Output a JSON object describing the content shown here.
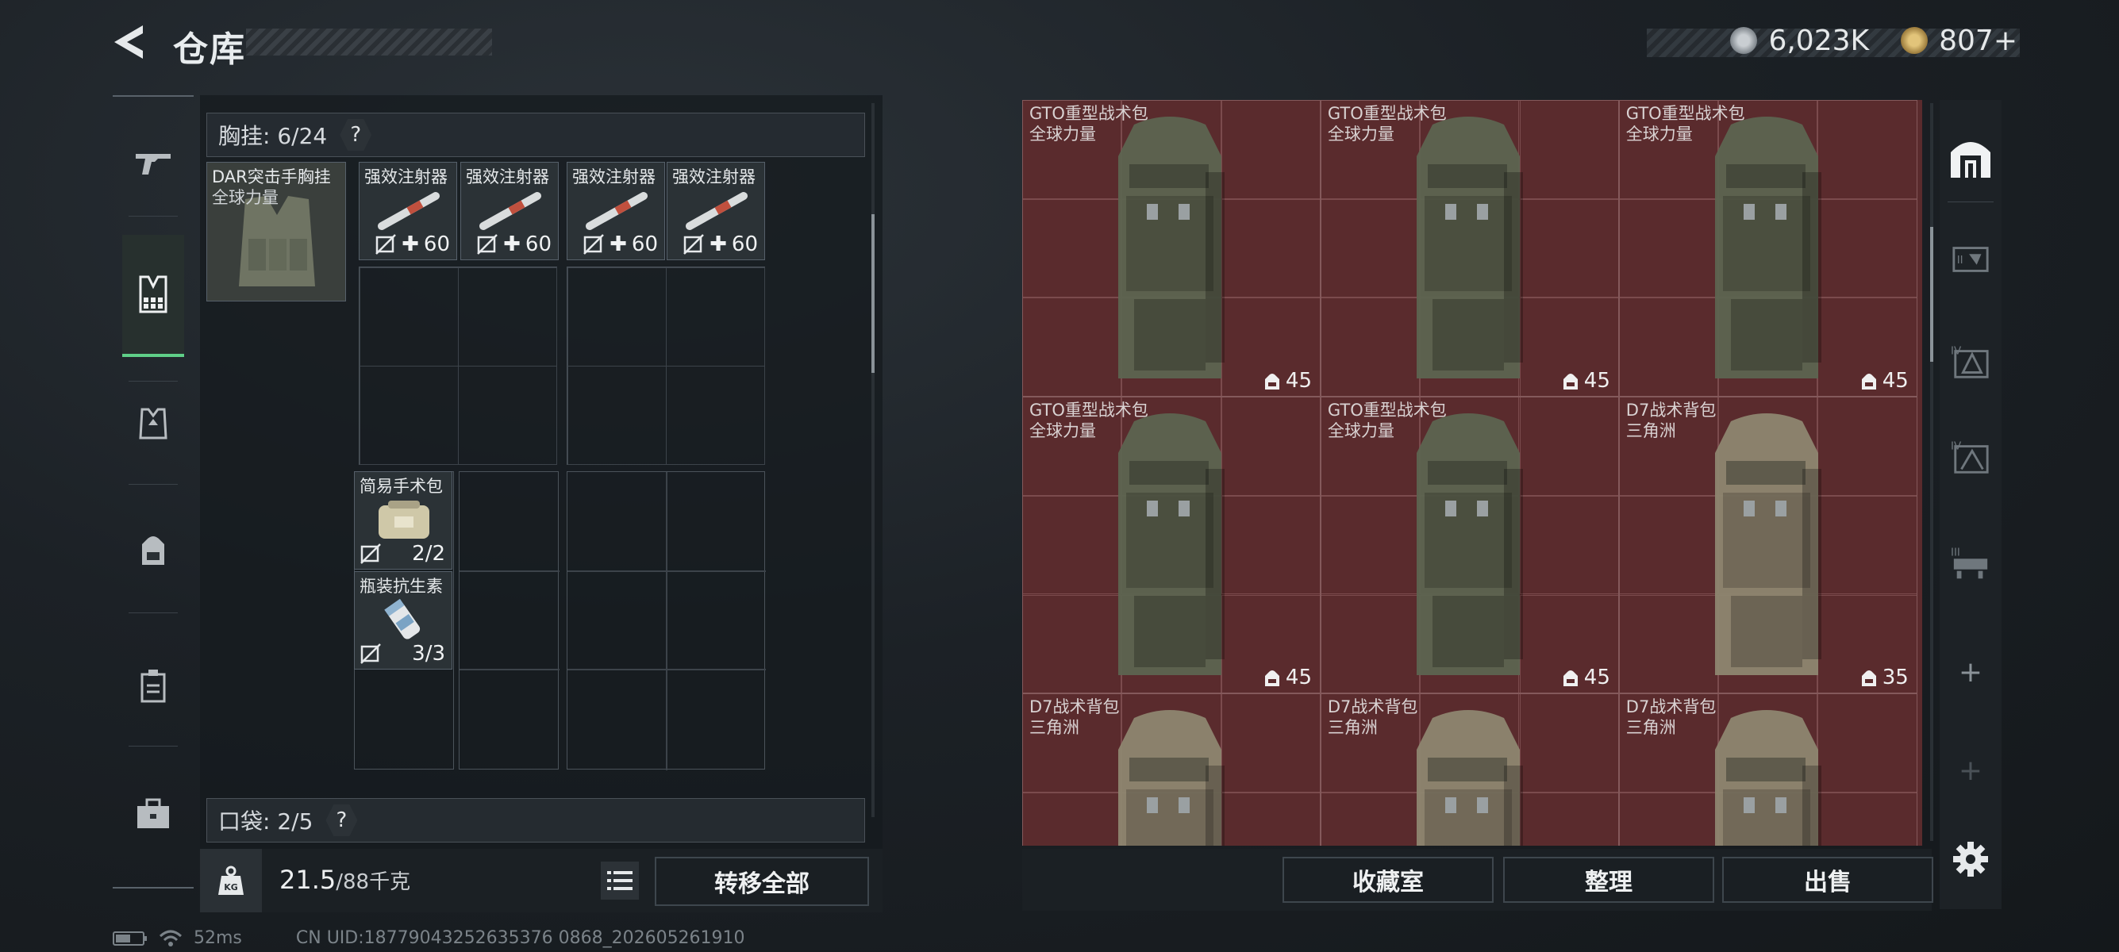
{
  "header": {
    "title": "仓库"
  },
  "currency": [
    {
      "icon": "silver-coin-icon",
      "value": "6,023K"
    },
    {
      "icon": "gold-coin-icon",
      "value": "807+"
    }
  ],
  "left_nav": [
    {
      "icon": "gun-icon"
    },
    {
      "icon": "chest-rig-icon",
      "active": true
    },
    {
      "icon": "armor-vest-icon"
    },
    {
      "icon": "backpack-icon"
    },
    {
      "icon": "container-icon"
    },
    {
      "icon": "toolbox-icon"
    }
  ],
  "chest_rig": {
    "label": "胸挂: 6/24",
    "help": "?",
    "equipped": {
      "name": "DAR突击手胸挂",
      "sub": "全球力量"
    },
    "items": [
      {
        "name": "强效注射器",
        "count": "60"
      },
      {
        "name": "强效注射器",
        "count": "60"
      },
      {
        "name": "强效注射器",
        "count": "60"
      },
      {
        "name": "强效注射器",
        "count": "60"
      },
      {
        "name": "简易手术包",
        "count": "2/2"
      },
      {
        "name": "瓶装抗生素",
        "count": "3/3"
      }
    ]
  },
  "pocket": {
    "label": "口袋: 2/5",
    "help": "?"
  },
  "weight": {
    "current": "21.5",
    "max": "/88千克",
    "icon": "KG"
  },
  "transfer_all": "转移全部",
  "warehouse_items": [
    {
      "name": "GTO重型战术包",
      "sub": "全球力量",
      "capacity": "45",
      "color": "#5d6450"
    },
    {
      "name": "GTO重型战术包",
      "sub": "全球力量",
      "capacity": "45",
      "color": "#5d6450"
    },
    {
      "name": "GTO重型战术包",
      "sub": "全球力量",
      "capacity": "45",
      "color": "#5d6450"
    },
    {
      "name": "GTO重型战术包",
      "sub": "全球力量",
      "capacity": "45",
      "color": "#5d6450"
    },
    {
      "name": "GTO重型战术包",
      "sub": "全球力量",
      "capacity": "45",
      "color": "#5d6450"
    },
    {
      "name": "D7战术背包",
      "sub": "三角洲",
      "capacity": "35",
      "color": "#8e8670"
    },
    {
      "name": "D7战术背包",
      "sub": "三角洲",
      "capacity": "",
      "color": "#8e8670"
    },
    {
      "name": "D7战术背包",
      "sub": "三角洲",
      "capacity": "",
      "color": "#8e8670"
    },
    {
      "name": "D7战术背包",
      "sub": "三角洲",
      "capacity": "",
      "color": "#8e8670"
    }
  ],
  "buttons": {
    "collection": "收藏室",
    "organize": "整理",
    "sell": "出售"
  },
  "right_nav": [
    {
      "icon": "warehouse-icon",
      "label": ""
    },
    {
      "icon": "storage-ii-icon",
      "label": ""
    },
    {
      "icon": "storage-iv-a-icon",
      "label": "IV"
    },
    {
      "icon": "storage-iv-b-icon",
      "label": "IV"
    },
    {
      "icon": "storage-iii-icon",
      "label": "III"
    },
    {
      "icon": "add-icon",
      "label": "+"
    },
    {
      "icon": "add-disabled-icon",
      "label": "+"
    }
  ],
  "status": {
    "ping": "52ms",
    "uid": "CN UID:18779043252635376 0868_202605261910"
  }
}
